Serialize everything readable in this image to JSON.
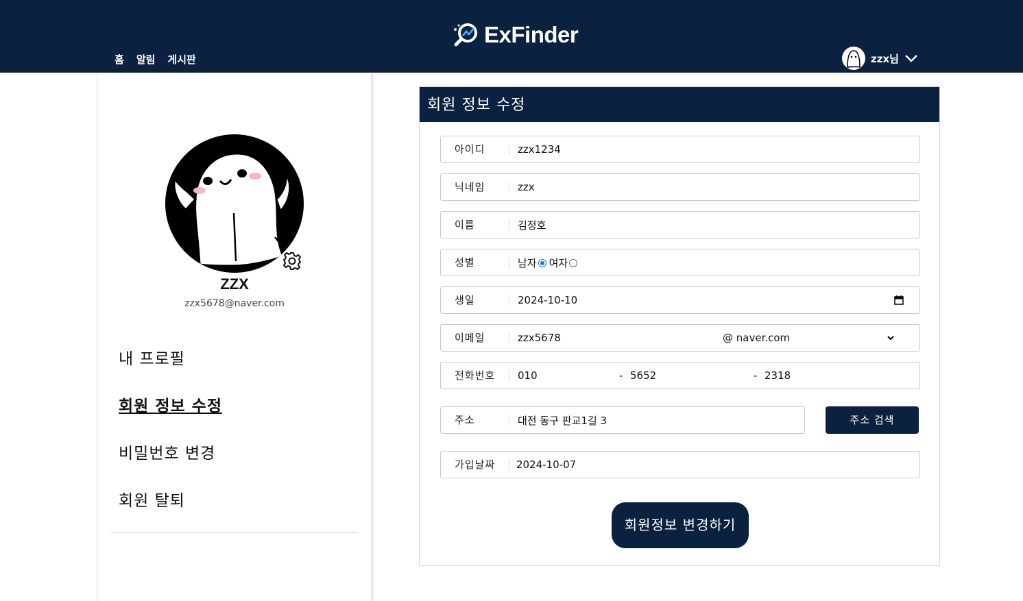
{
  "header": {
    "logo_text": "ExFinder",
    "nav": [
      "홈",
      "알림",
      "게시판"
    ],
    "user_name": "zzx님"
  },
  "sidebar": {
    "profile_name": "ZZX",
    "profile_email": "zzx5678@naver.com",
    "menu": [
      "내 프로필",
      "회원 정보 수정",
      "비밀번호 변경",
      "회원 탈퇴"
    ],
    "active_index": 1
  },
  "form": {
    "title": "회원 정보 수정",
    "id_label": "아이디",
    "id_value": "zzx1234",
    "nickname_label": "닉네임",
    "nickname_value": "zzx",
    "name_label": "이름",
    "name_value": "김정호",
    "gender_label": "성별",
    "gender_male": "남자",
    "gender_female": "여자",
    "gender_selected": "남자",
    "birth_label": "생일",
    "birth_value": "2024-10-10",
    "email_label": "이메일",
    "email_local": "zzx5678",
    "email_domain": "@ naver.com",
    "phone_label": "전화번호",
    "phone_1": "010",
    "phone_2": "5652",
    "phone_3": "2318",
    "phone_sep": "-",
    "address_label": "주소",
    "address_value": "대전 동구 판교1길 3",
    "address_search_button": "주소 검색",
    "joined_label": "가입날짜",
    "joined_value": "2024-10-07",
    "submit_button": "회원정보 변경하기"
  },
  "colors": {
    "primary": "#0a2140",
    "radio": "#1a73e8"
  }
}
